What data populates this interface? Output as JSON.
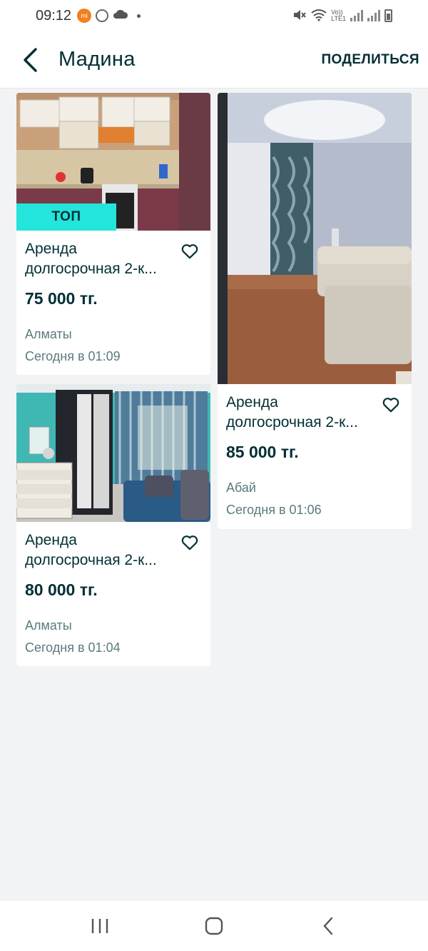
{
  "status_bar": {
    "time": "09:12",
    "volte_label": "Vo))",
    "lte_label": "LTE1",
    "icons": [
      "app-notification-icon",
      "sync-icon",
      "cloud-icon",
      "dot-icon",
      "mute-icon",
      "wifi-icon",
      "signal-icon",
      "signal-icon",
      "battery-icon"
    ]
  },
  "app_bar": {
    "title": "Мадина",
    "share_label": "ПОДЕЛИТЬСЯ",
    "back_icon": "back-arrow-icon"
  },
  "listings": [
    {
      "badge": "ТОП",
      "title": "Аренда долгосрочная 2-к...",
      "price": "75 000 тг.",
      "location": "Алматы",
      "date": "Сегодня в 01:09",
      "photo": "kitchen-photo"
    },
    {
      "title": "Аренда долгосрочная 2-к...",
      "price": "85 000 тг.",
      "location": "Абай",
      "date": "Сегодня в 01:06",
      "photo": "living-room-photo"
    },
    {
      "title": "Аренда долгосрочная 2-к...",
      "price": "80 000 тг.",
      "location": "Алматы",
      "date": "Сегодня в 01:04",
      "photo": "bedroom-photo"
    }
  ],
  "nav_bar": {
    "icons": [
      "recent-apps-icon",
      "home-icon",
      "back-icon"
    ]
  },
  "colors": {
    "accent_badge": "#23e5db",
    "text_primary": "#002f34",
    "text_secondary": "#5b7a7d",
    "background": "#f2f3f5"
  }
}
